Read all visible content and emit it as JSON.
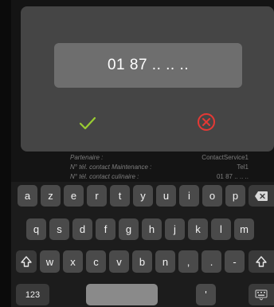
{
  "dialog": {
    "value": "01 87 .. .. ..",
    "ok_icon": "checkmark-icon",
    "cancel_icon": "cancel-circle-icon",
    "accent_ok": "#9acd32",
    "accent_cancel": "#e53935"
  },
  "info": [
    {
      "label": "Partenaire :",
      "value": "ContactService1"
    },
    {
      "label": "N° tél. contact Maintenance :",
      "value": "Tel1"
    },
    {
      "label": "N° tél. contact culinaire :",
      "value": "01 87 .. .. .."
    }
  ],
  "keyboard": {
    "row1": [
      "a",
      "z",
      "e",
      "r",
      "t",
      "y",
      "u",
      "i",
      "o",
      "p"
    ],
    "row2": [
      "q",
      "s",
      "d",
      "f",
      "g",
      "h",
      "j",
      "k",
      "l",
      "m"
    ],
    "row3": [
      "w",
      "x",
      "c",
      "v",
      "b",
      "n",
      ",",
      ".",
      "-"
    ],
    "numbers_label": "123",
    "apostrophe": "'",
    "backspace_icon": "backspace-icon",
    "shift_icon": "shift-icon",
    "hide_keyboard_icon": "keyboard-hide-icon"
  }
}
